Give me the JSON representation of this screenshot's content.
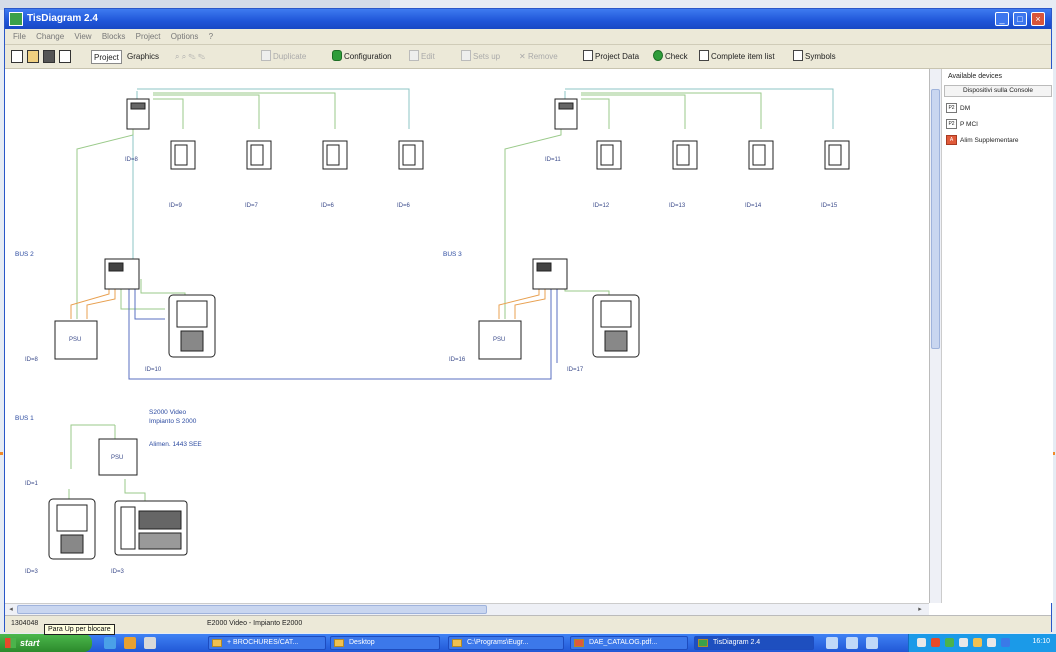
{
  "window": {
    "title": "TisDiagram 2.4",
    "buttons": {
      "minimize": "_",
      "maximize": "□",
      "close": "×"
    }
  },
  "menu": [
    "File",
    "Change",
    "View",
    "Blocks",
    "Project",
    "Options",
    "?"
  ],
  "toolbar": {
    "project": "Project",
    "graphics": "Graphics",
    "duplicate": "Duplicate",
    "configuration": "Configuration",
    "edit": "Edit",
    "something": "Sets up",
    "remove": "Remove",
    "project_data": "Project Data",
    "check": "Check",
    "complete_item_list": "Complete item list",
    "symbols": "Symbols"
  },
  "diagram": {
    "bus_labels": [
      "BUS 2",
      "BUS 3",
      "BUS 1"
    ],
    "ids_top_left": [
      "ID=8",
      "ID=9",
      "ID=7",
      "ID=6",
      "ID=6"
    ],
    "ids_top_right": [
      "ID=11",
      "ID=12",
      "ID=13",
      "ID=14",
      "ID=15"
    ],
    "id_small_left": "ID=1",
    "id_interface_left": "ID=8",
    "id_panel_left": "ID=10",
    "id_interface_right": "ID=16",
    "id_panel_right": "ID=17",
    "id_bus1": "ID=1",
    "id_bottom_a": "ID=3",
    "id_bottom_b": "ID=3",
    "note_line1": "S2000 Video",
    "note_line2": "Impianto S 2000",
    "note_line3": "Alimen. 1443 SEE",
    "device_text": "PSU"
  },
  "sidebar": {
    "title": "Available devices",
    "header": "Dispositivi sulla Console",
    "items": [
      {
        "badge": "P2",
        "label": "DM"
      },
      {
        "badge": "P2",
        "label": "P MCI"
      },
      {
        "badge": "A",
        "label": "Alim Supplementare"
      }
    ]
  },
  "status": {
    "left": "1304048",
    "mid": "E2000 Video - Impianto E2000",
    "tooltip": "Para Up per blocare"
  },
  "taskbar": {
    "start": "start",
    "tasks": [
      "+ BROCHURES/CAT...",
      "Desktop",
      "C:\\Programs\\Eugr...",
      "DAE_CATALOG.pdf...",
      "TisDiagram 2.4"
    ],
    "clock": "16:10"
  },
  "colors": {
    "titlebar": "#1f55d8",
    "wire_green": "#9aca8a",
    "wire_orange": "#e8a050",
    "wire_blue": "#5a6fc0",
    "wire_teal": "#8cc4c4"
  }
}
